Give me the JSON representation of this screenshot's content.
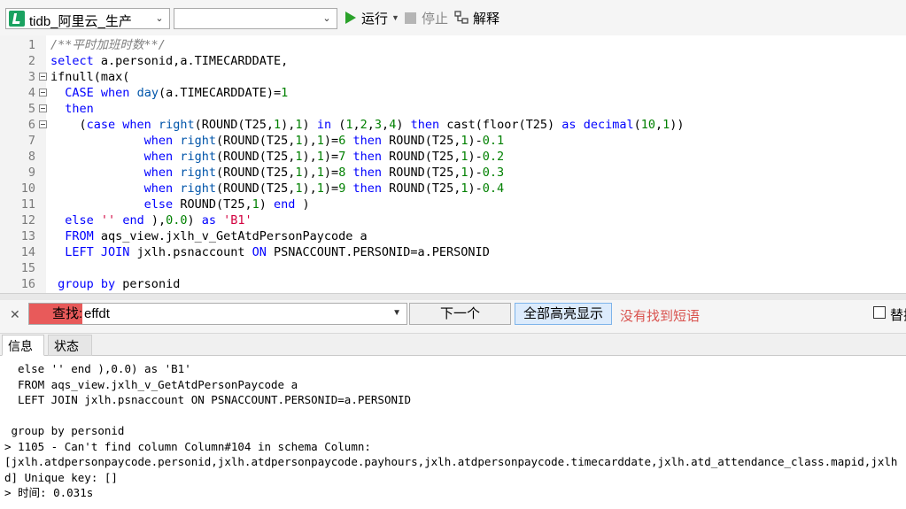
{
  "toolbar": {
    "connection": "tidb_阿里云_生产",
    "database": "",
    "run_label": "运行",
    "stop_label": "停止",
    "explain_label": "解释"
  },
  "editor": {
    "lines": [
      {
        "n": "1",
        "tokens": [
          [
            "c",
            "/**平时加班时数**/"
          ]
        ]
      },
      {
        "n": "2",
        "tokens": [
          [
            "k",
            "select"
          ],
          [
            "",
            " a.personid,a.TIMECARDDATE,"
          ]
        ]
      },
      {
        "n": "3",
        "fold": true,
        "tokens": [
          [
            "",
            "ifnull(max("
          ]
        ]
      },
      {
        "n": "4",
        "fold": true,
        "tokens": [
          [
            "",
            "  "
          ],
          [
            "k",
            "CASE"
          ],
          [
            "",
            " "
          ],
          [
            "k",
            "when"
          ],
          [
            "",
            " "
          ],
          [
            "f",
            "day"
          ],
          [
            "",
            "(a.TIMECARDDATE)="
          ],
          [
            "n",
            "1"
          ]
        ]
      },
      {
        "n": "5",
        "fold": true,
        "tokens": [
          [
            "",
            "  "
          ],
          [
            "k",
            "then"
          ]
        ]
      },
      {
        "n": "6",
        "fold": true,
        "tokens": [
          [
            "",
            "    ("
          ],
          [
            "k",
            "case"
          ],
          [
            "",
            " "
          ],
          [
            "k",
            "when"
          ],
          [
            "",
            " "
          ],
          [
            "f",
            "right"
          ],
          [
            "",
            "(ROUND(T25,"
          ],
          [
            "n",
            "1"
          ],
          [
            "",
            "),"
          ],
          [
            "n",
            "1"
          ],
          [
            "",
            ") "
          ],
          [
            "k",
            "in"
          ],
          [
            "",
            " ("
          ],
          [
            "n",
            "1"
          ],
          [
            "",
            ","
          ],
          [
            "n",
            "2"
          ],
          [
            "",
            ","
          ],
          [
            "n",
            "3"
          ],
          [
            "",
            ","
          ],
          [
            "n",
            "4"
          ],
          [
            "",
            ") "
          ],
          [
            "k",
            "then"
          ],
          [
            "",
            " cast(floor(T25) "
          ],
          [
            "k",
            "as"
          ],
          [
            "",
            " "
          ],
          [
            "k",
            "decimal"
          ],
          [
            "",
            "("
          ],
          [
            "n",
            "10"
          ],
          [
            "",
            ","
          ],
          [
            "n",
            "1"
          ],
          [
            "",
            "))"
          ]
        ]
      },
      {
        "n": "7",
        "tokens": [
          [
            "",
            "             "
          ],
          [
            "k",
            "when"
          ],
          [
            "",
            " "
          ],
          [
            "f",
            "right"
          ],
          [
            "",
            "(ROUND(T25,"
          ],
          [
            "n",
            "1"
          ],
          [
            "",
            "),"
          ],
          [
            "n",
            "1"
          ],
          [
            "",
            ")="
          ],
          [
            "n",
            "6"
          ],
          [
            "",
            " "
          ],
          [
            "k",
            "then"
          ],
          [
            "",
            " ROUND(T25,"
          ],
          [
            "n",
            "1"
          ],
          [
            "",
            ")-"
          ],
          [
            "n",
            "0.1"
          ]
        ]
      },
      {
        "n": "8",
        "tokens": [
          [
            "",
            "             "
          ],
          [
            "k",
            "when"
          ],
          [
            "",
            " "
          ],
          [
            "f",
            "right"
          ],
          [
            "",
            "(ROUND(T25,"
          ],
          [
            "n",
            "1"
          ],
          [
            "",
            "),"
          ],
          [
            "n",
            "1"
          ],
          [
            "",
            ")="
          ],
          [
            "n",
            "7"
          ],
          [
            "",
            " "
          ],
          [
            "k",
            "then"
          ],
          [
            "",
            " ROUND(T25,"
          ],
          [
            "n",
            "1"
          ],
          [
            "",
            ")-"
          ],
          [
            "n",
            "0.2"
          ]
        ]
      },
      {
        "n": "9",
        "tokens": [
          [
            "",
            "             "
          ],
          [
            "k",
            "when"
          ],
          [
            "",
            " "
          ],
          [
            "f",
            "right"
          ],
          [
            "",
            "(ROUND(T25,"
          ],
          [
            "n",
            "1"
          ],
          [
            "",
            "),"
          ],
          [
            "n",
            "1"
          ],
          [
            "",
            ")="
          ],
          [
            "n",
            "8"
          ],
          [
            "",
            " "
          ],
          [
            "k",
            "then"
          ],
          [
            "",
            " ROUND(T25,"
          ],
          [
            "n",
            "1"
          ],
          [
            "",
            ")-"
          ],
          [
            "n",
            "0.3"
          ]
        ]
      },
      {
        "n": "10",
        "tokens": [
          [
            "",
            "             "
          ],
          [
            "k",
            "when"
          ],
          [
            "",
            " "
          ],
          [
            "f",
            "right"
          ],
          [
            "",
            "(ROUND(T25,"
          ],
          [
            "n",
            "1"
          ],
          [
            "",
            "),"
          ],
          [
            "n",
            "1"
          ],
          [
            "",
            ")="
          ],
          [
            "n",
            "9"
          ],
          [
            "",
            " "
          ],
          [
            "k",
            "then"
          ],
          [
            "",
            " ROUND(T25,"
          ],
          [
            "n",
            "1"
          ],
          [
            "",
            ")-"
          ],
          [
            "n",
            "0.4"
          ]
        ]
      },
      {
        "n": "11",
        "tokens": [
          [
            "",
            "             "
          ],
          [
            "k",
            "else"
          ],
          [
            "",
            " ROUND(T25,"
          ],
          [
            "n",
            "1"
          ],
          [
            "",
            ") "
          ],
          [
            "k",
            "end"
          ],
          [
            "",
            " )"
          ]
        ]
      },
      {
        "n": "12",
        "tokens": [
          [
            "",
            "  "
          ],
          [
            "k",
            "else"
          ],
          [
            "",
            " "
          ],
          [
            "s",
            "''"
          ],
          [
            "",
            " "
          ],
          [
            "k",
            "end"
          ],
          [
            "",
            " ),"
          ],
          [
            "n",
            "0.0"
          ],
          [
            "",
            ") "
          ],
          [
            "k",
            "as"
          ],
          [
            "",
            " "
          ],
          [
            "s",
            "'B1'"
          ]
        ]
      },
      {
        "n": "13",
        "tokens": [
          [
            "",
            "  "
          ],
          [
            "k",
            "FROM"
          ],
          [
            "",
            " aqs_view.jxlh_v_GetAtdPersonPaycode a"
          ]
        ]
      },
      {
        "n": "14",
        "tokens": [
          [
            "",
            "  "
          ],
          [
            "k",
            "LEFT JOIN"
          ],
          [
            "",
            " jxlh.psnaccount "
          ],
          [
            "k",
            "ON"
          ],
          [
            "",
            " PSNACCOUNT.PERSONID=a.PERSONID"
          ]
        ]
      },
      {
        "n": "15",
        "tokens": []
      },
      {
        "n": "16",
        "tokens": [
          [
            "",
            " "
          ],
          [
            "k",
            "group by"
          ],
          [
            "",
            " personid"
          ]
        ]
      }
    ]
  },
  "findbar": {
    "label": "查找:",
    "query": "effdt",
    "next_label": "下一个",
    "highlight_all_label": "全部高亮显示",
    "status": "没有找到短语",
    "replace_label": "替换"
  },
  "tabs": {
    "info": "信息",
    "status": "状态"
  },
  "output": {
    "lines": [
      "  else '' end ),0.0) as 'B1'",
      "  FROM aqs_view.jxlh_v_GetAtdPersonPaycode a",
      "  LEFT JOIN jxlh.psnaccount ON PSNACCOUNT.PERSONID=a.PERSONID",
      "",
      " group by personid",
      "> 1105 - Can't find column Column#104 in schema Column: ",
      "[jxlh.atdpersonpaycode.personid,jxlh.atdpersonpaycode.payhours,jxlh.atdpersonpaycode.timecarddate,jxlh.atd_attendance_class.mapid,jxlh",
      "d] Unique key: []",
      "> 时间: 0.031s"
    ]
  },
  "colors": {
    "keyword": "#0000ff",
    "number": "#008000",
    "string": "#d2003e",
    "comment": "#808080",
    "find_label_bg": "#e85a5a",
    "status_error": "#d9534f"
  }
}
